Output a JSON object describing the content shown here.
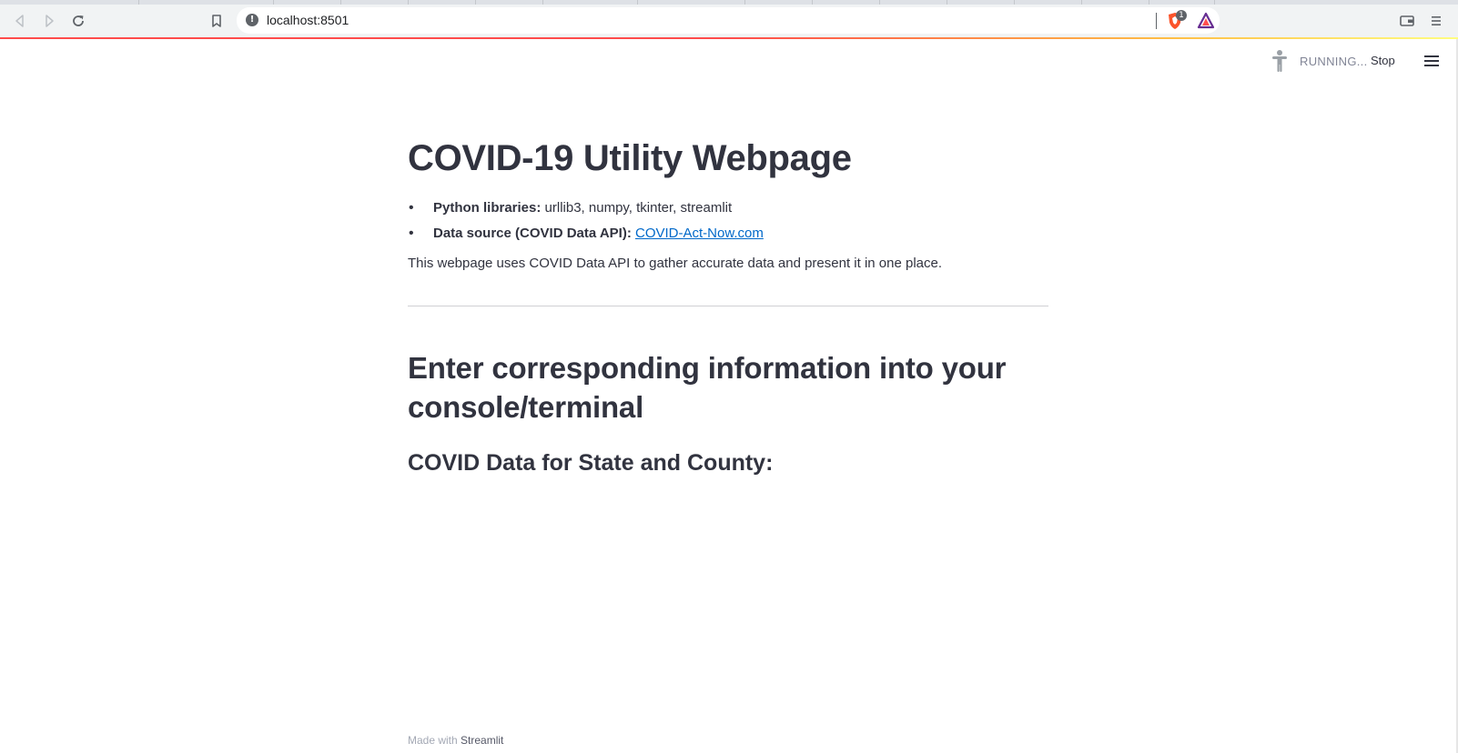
{
  "browser": {
    "url": "localhost:8501",
    "shields_badge": "1"
  },
  "header": {
    "status": "RUNNING...",
    "stop_label": "Stop"
  },
  "main": {
    "title": "COVID-19 Utility Webpage",
    "bullets": [
      {
        "label": "Python libraries:",
        "text": "urllib3, numpy, tkinter, streamlit"
      },
      {
        "label": "Data source (COVID Data API):",
        "link": "COVID-Act-Now.com"
      }
    ],
    "description": "This webpage uses COVID Data API to gather accurate data and present it in one place.",
    "section_heading": "Enter corresponding information into your console/terminal",
    "subheading": "COVID Data for State and County:"
  },
  "footer": {
    "prefix": "Made with",
    "brand": "Streamlit"
  },
  "colors": {
    "accent": "#ff4b4b",
    "link": "#0068c9",
    "text": "#31333f"
  }
}
